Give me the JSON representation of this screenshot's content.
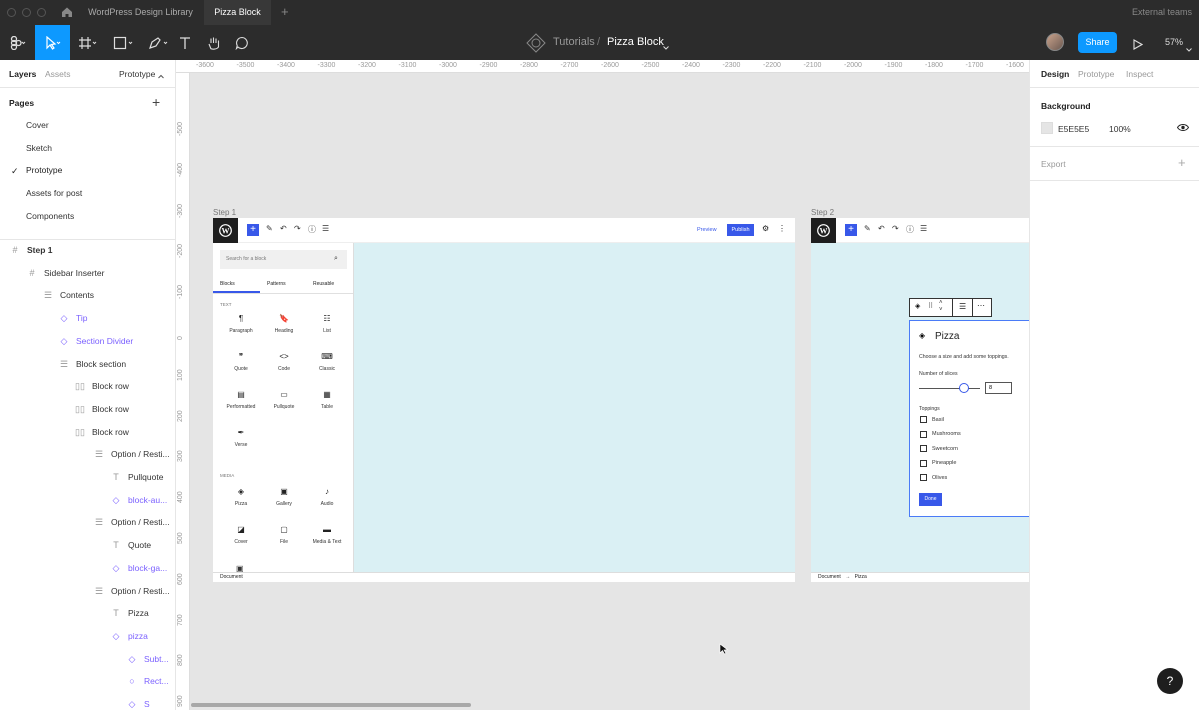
{
  "tabs": {
    "home_icon": "home-icon",
    "library": "WordPress Design Library",
    "active": "Pizza Block",
    "add": "+",
    "external": "External teams"
  },
  "toolbar": {
    "breadcrumb_parent": "Tutorials",
    "separator": "/",
    "file_name": "Pizza Block",
    "share": "Share",
    "zoom": "57%"
  },
  "left_panel": {
    "tab_layers": "Layers",
    "tab_assets": "Assets",
    "tab_prototype": "Prototype",
    "pages_title": "Pages",
    "add_page": "+",
    "pages": [
      "Cover",
      "Sketch",
      "Prototype",
      "Assets for post",
      "Components"
    ],
    "checkmark": "✓",
    "layers": [
      {
        "label": "Step 1",
        "icon": "#",
        "indent": 0,
        "bold": true,
        "purple": false
      },
      {
        "label": "Sidebar Inserter",
        "icon": "#",
        "indent": 1,
        "bold": false,
        "purple": false
      },
      {
        "label": "Contents",
        "icon": "☰",
        "indent": 2,
        "bold": false,
        "purple": false
      },
      {
        "label": "Tip",
        "icon": "◇",
        "indent": 3,
        "bold": false,
        "purple": true
      },
      {
        "label": "Section Divider",
        "icon": "◇",
        "indent": 3,
        "bold": false,
        "purple": true
      },
      {
        "label": "Block section",
        "icon": "☰",
        "indent": 3,
        "bold": false,
        "purple": false
      },
      {
        "label": "Block row",
        "icon": "▯▯",
        "indent": 4,
        "bold": false,
        "purple": false
      },
      {
        "label": "Block row",
        "icon": "▯▯",
        "indent": 4,
        "bold": false,
        "purple": false
      },
      {
        "label": "Block row",
        "icon": "▯▯",
        "indent": 4,
        "bold": false,
        "purple": false
      },
      {
        "label": "Option / Resti...",
        "icon": "☰",
        "indent": 5,
        "bold": false,
        "purple": false
      },
      {
        "label": "Pullquote",
        "icon": "T",
        "indent": 6,
        "bold": false,
        "purple": false
      },
      {
        "label": "block-au...",
        "icon": "◇",
        "indent": 6,
        "bold": false,
        "purple": true
      },
      {
        "label": "Option / Resti...",
        "icon": "☰",
        "indent": 5,
        "bold": false,
        "purple": false
      },
      {
        "label": "Quote",
        "icon": "T",
        "indent": 6,
        "bold": false,
        "purple": false
      },
      {
        "label": "block-ga...",
        "icon": "◇",
        "indent": 6,
        "bold": false,
        "purple": true
      },
      {
        "label": "Option / Resti...",
        "icon": "☰",
        "indent": 5,
        "bold": false,
        "purple": false
      },
      {
        "label": "Pizza",
        "icon": "T",
        "indent": 6,
        "bold": false,
        "purple": false
      },
      {
        "label": "pizza",
        "icon": "◇",
        "indent": 6,
        "bold": false,
        "purple": true
      },
      {
        "label": "Subt...",
        "icon": "◇",
        "indent": 7,
        "bold": false,
        "purple": true
      },
      {
        "label": "Rect...",
        "icon": "○",
        "indent": 7,
        "bold": false,
        "purple": true
      },
      {
        "label": "S",
        "icon": "◇",
        "indent": 7,
        "bold": false,
        "purple": true
      }
    ]
  },
  "ruler_top": [
    "-3600",
    "-3500",
    "-3400",
    "-3300",
    "-3200",
    "-3100",
    "-3000",
    "-2900",
    "-2800",
    "-2700",
    "-2600",
    "-2500",
    "-2400",
    "-2300",
    "-2200",
    "-2100",
    "-2000",
    "-1900",
    "-1800",
    "-1700",
    "-1600"
  ],
  "ruler_left": [
    "-500",
    "-400",
    "-300",
    "-200",
    "-100",
    "0",
    "100",
    "200",
    "300",
    "400",
    "500",
    "600",
    "700",
    "800",
    "900"
  ],
  "right_panel": {
    "tab_design": "Design",
    "tab_prototype": "Prototype",
    "tab_inspect": "Inspect",
    "background_title": "Background",
    "bg_hex": "E5E5E5",
    "bg_opacity": "100%",
    "export_title": "Export",
    "export_add": "+",
    "bg_color": "#e5e5e5"
  },
  "step1": {
    "label": "Step 1",
    "preview": "Preview",
    "publish": "Publish",
    "search_placeholder": "Search for a block",
    "tab_blocks": "Blocks",
    "tab_patterns": "Patterns",
    "tab_reusable": "Reusable",
    "section_text": "TEXT",
    "section_media": "MEDIA",
    "text_blocks": [
      {
        "glyph": "¶",
        "label": "Paragraph"
      },
      {
        "glyph": "🔖",
        "label": "Heading"
      },
      {
        "glyph": "☷",
        "label": "List"
      },
      {
        "glyph": "❞",
        "label": "Quote"
      },
      {
        "glyph": "<>",
        "label": "Code"
      },
      {
        "glyph": "⌨",
        "label": "Classic"
      },
      {
        "glyph": "▤",
        "label": "Performatted"
      },
      {
        "glyph": "▭",
        "label": "Pullquote"
      },
      {
        "glyph": "▦",
        "label": "Table"
      },
      {
        "glyph": "✒",
        "label": "Verse"
      }
    ],
    "media_blocks": [
      {
        "glyph": "◈",
        "label": "Pizza"
      },
      {
        "glyph": "▣",
        "label": "Gallery"
      },
      {
        "glyph": "♪",
        "label": "Audio"
      },
      {
        "glyph": "◪",
        "label": "Cover"
      },
      {
        "glyph": "▢",
        "label": "File"
      },
      {
        "glyph": "▬",
        "label": "Media & Text"
      }
    ],
    "footer": "Document"
  },
  "step2": {
    "label": "Step 2",
    "block_title": "Pizza",
    "description": "Choose a size and add some toppings.",
    "slices_label": "Number of slices",
    "slices_value": "8",
    "toppings_label": "Toppings",
    "toppings": [
      "Basil",
      "Mushrooms",
      "Sweetcorn",
      "Pineapple",
      "Olives"
    ],
    "done": "Done",
    "footer_doc": "Document",
    "footer_arrow": "→",
    "footer_block": "Pizza"
  },
  "help": "?",
  "colors": {
    "accent": "#0d99ff",
    "wp_blue": "#3858e9",
    "selection": "#4a7bf7",
    "canvas": "#daf0f4"
  }
}
